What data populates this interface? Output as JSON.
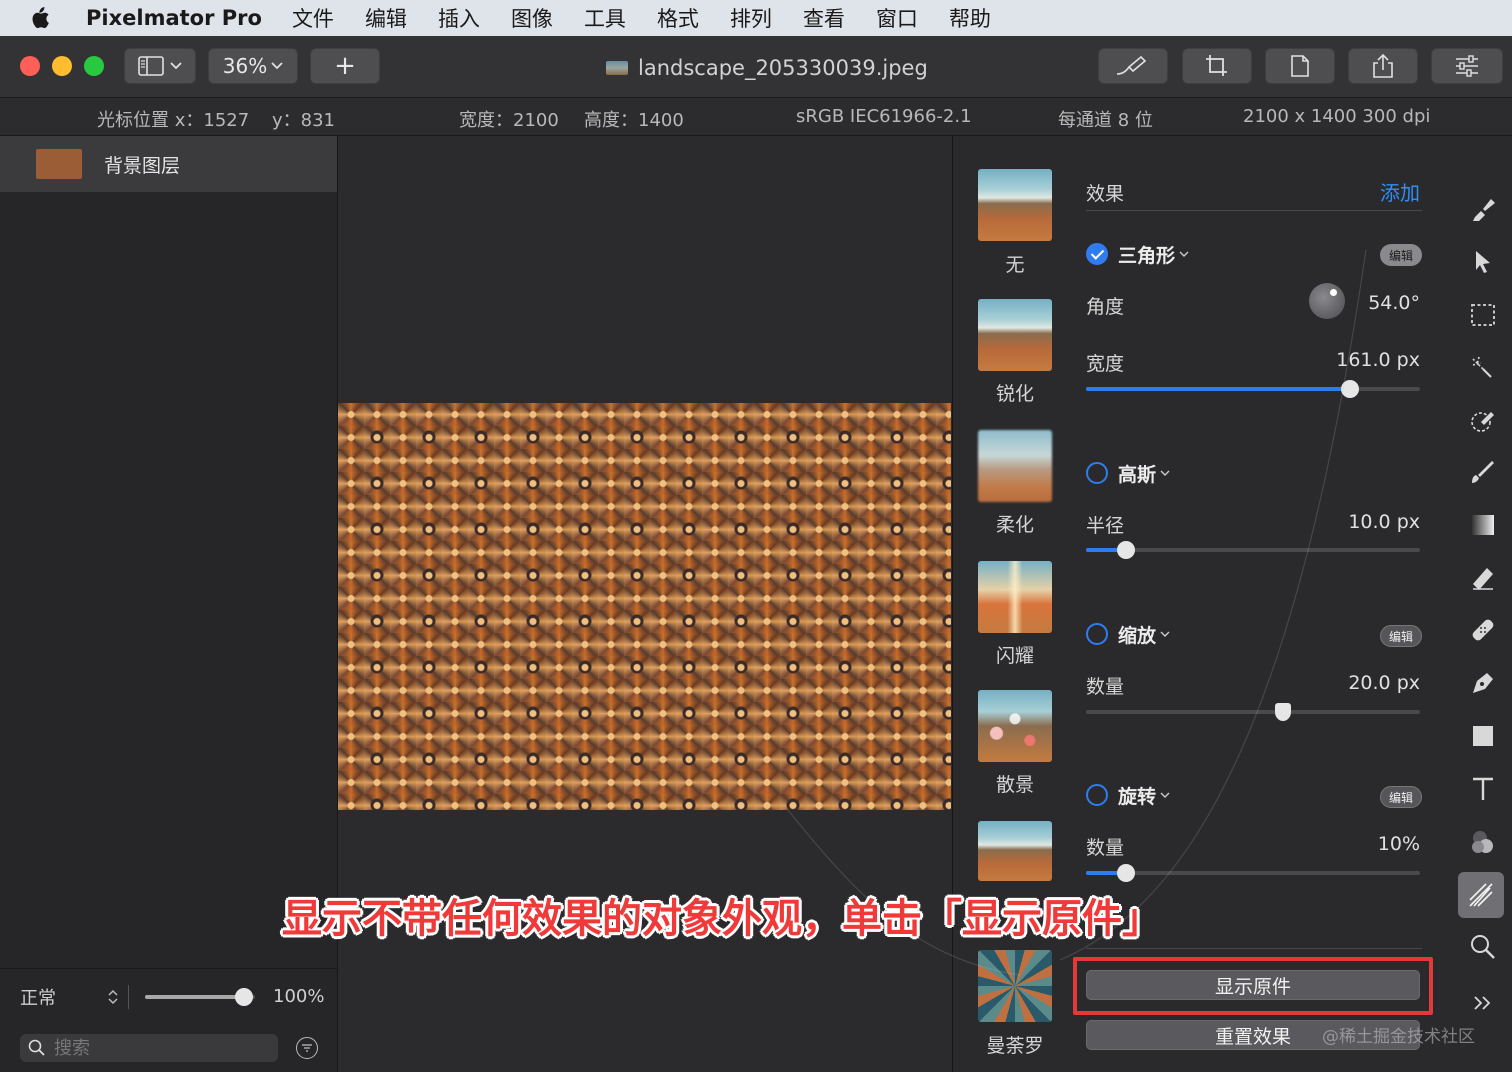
{
  "menubar": {
    "app_name": "Pixelmator Pro",
    "items": [
      "文件",
      "编辑",
      "插入",
      "图像",
      "工具",
      "格式",
      "排列",
      "查看",
      "窗口",
      "帮助"
    ]
  },
  "toolbar": {
    "zoom": "36%",
    "add_label": "+",
    "doc_title": "landscape_205330039.jpeg"
  },
  "infobar": {
    "cursor_x": "光标位置 x：1527",
    "cursor_y": "y：831",
    "width": "宽度：2100",
    "height": "高度：1400",
    "color_profile": "sRGB IEC61966-2.1",
    "bit_depth": "每通道 8 位",
    "dimensions": "2100 x 1400 300 dpi"
  },
  "layers": {
    "items": [
      {
        "name": "背景图层"
      }
    ],
    "blend_mode": "正常",
    "opacity": "100%",
    "opacity_fraction": 0.9,
    "search_placeholder": "搜索"
  },
  "effect_presets": [
    "无",
    "锐化",
    "柔化",
    "闪耀",
    "散景",
    "曼荼罗"
  ],
  "effects_panel": {
    "header": "效果",
    "add_label": "添加",
    "edit_label": "编辑",
    "triangle": {
      "name": "三角形",
      "enabled": true,
      "angle_label": "角度",
      "angle_value": "54.0°",
      "width_label": "宽度",
      "width_value": "161.0 px",
      "width_fraction": 0.79
    },
    "gaussian": {
      "name": "高斯",
      "enabled": false,
      "radius_label": "半径",
      "radius_value": "10.0 px",
      "radius_fraction": 0.12
    },
    "zoom": {
      "name": "缩放",
      "enabled": false,
      "amount_label": "数量",
      "amount_value": "20.0 px",
      "amount_fraction": 0.59
    },
    "twirl": {
      "name": "旋转",
      "enabled": false,
      "amount_label": "数量",
      "amount_value": "10%",
      "amount_fraction": 0.12
    },
    "show_original": "显示原件",
    "reset_effects": "重置效果"
  },
  "annotation": "显示不带任何效果的对象外观，单击「显示原件」",
  "watermark": "@稀土掘金技术社区",
  "colors": {
    "accent": "#2f7cf0",
    "highlight": "#e23a3a",
    "canvas_pattern": "#a5511d"
  },
  "icons": [
    "apple-icon",
    "sidebar-toggle-icon",
    "chevron-down-icon",
    "brush-stroke-icon",
    "crop-icon",
    "document-icon",
    "share-icon",
    "sliders-icon",
    "search-icon",
    "filter-icon",
    "style-tool-icon",
    "arrange-tool-icon",
    "selection-tool-icon",
    "magic-selection-icon",
    "color-picker-icon",
    "paint-brush-icon",
    "gradient-icon",
    "eraser-icon",
    "repair-icon",
    "pen-icon",
    "shape-icon",
    "type-icon",
    "color-adjust-icon",
    "effects-icon",
    "zoom-tool-icon",
    "more-tools-icon"
  ]
}
